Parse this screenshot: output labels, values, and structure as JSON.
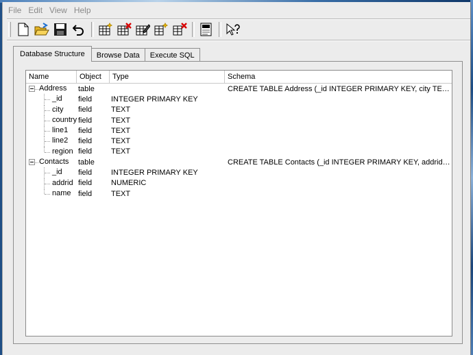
{
  "menu": [
    "File",
    "Edit",
    "View",
    "Help"
  ],
  "toolbar": [
    {
      "icon": "new-database-icon"
    },
    {
      "icon": "open-database-icon"
    },
    {
      "icon": "save-icon"
    },
    {
      "icon": "undo-icon"
    },
    {
      "icon": "create-table-icon"
    },
    {
      "icon": "delete-table-icon"
    },
    {
      "icon": "modify-table-icon"
    },
    {
      "icon": "create-index-icon"
    },
    {
      "icon": "delete-index-icon"
    },
    {
      "icon": "log-window-icon"
    },
    {
      "icon": "whats-this-help-icon"
    }
  ],
  "tabs": [
    {
      "label": "Database Structure",
      "active": true
    },
    {
      "label": "Browse Data",
      "active": false
    },
    {
      "label": "Execute SQL",
      "active": false
    }
  ],
  "columns": [
    "Name",
    "Object",
    "Type",
    "Schema"
  ],
  "tables": [
    {
      "name": "Address",
      "object": "table",
      "schema": "CREATE TABLE Address (_id INTEGER PRIMARY KEY, city TEXT, country TE...",
      "fields": [
        {
          "name": "_id",
          "object": "field",
          "type": "INTEGER PRIMARY KEY"
        },
        {
          "name": "city",
          "object": "field",
          "type": "TEXT"
        },
        {
          "name": "country",
          "object": "field",
          "type": "TEXT"
        },
        {
          "name": "line1",
          "object": "field",
          "type": "TEXT"
        },
        {
          "name": "line2",
          "object": "field",
          "type": "TEXT"
        },
        {
          "name": "region",
          "object": "field",
          "type": "TEXT"
        }
      ]
    },
    {
      "name": "Contacts",
      "object": "table",
      "schema": "CREATE TABLE Contacts (_id INTEGER PRIMARY KEY, addrid NUMERIC, na...",
      "fields": [
        {
          "name": "_id",
          "object": "field",
          "type": "INTEGER PRIMARY KEY"
        },
        {
          "name": "addrid",
          "object": "field",
          "type": "NUMERIC"
        },
        {
          "name": "name",
          "object": "field",
          "type": "TEXT"
        }
      ]
    }
  ]
}
